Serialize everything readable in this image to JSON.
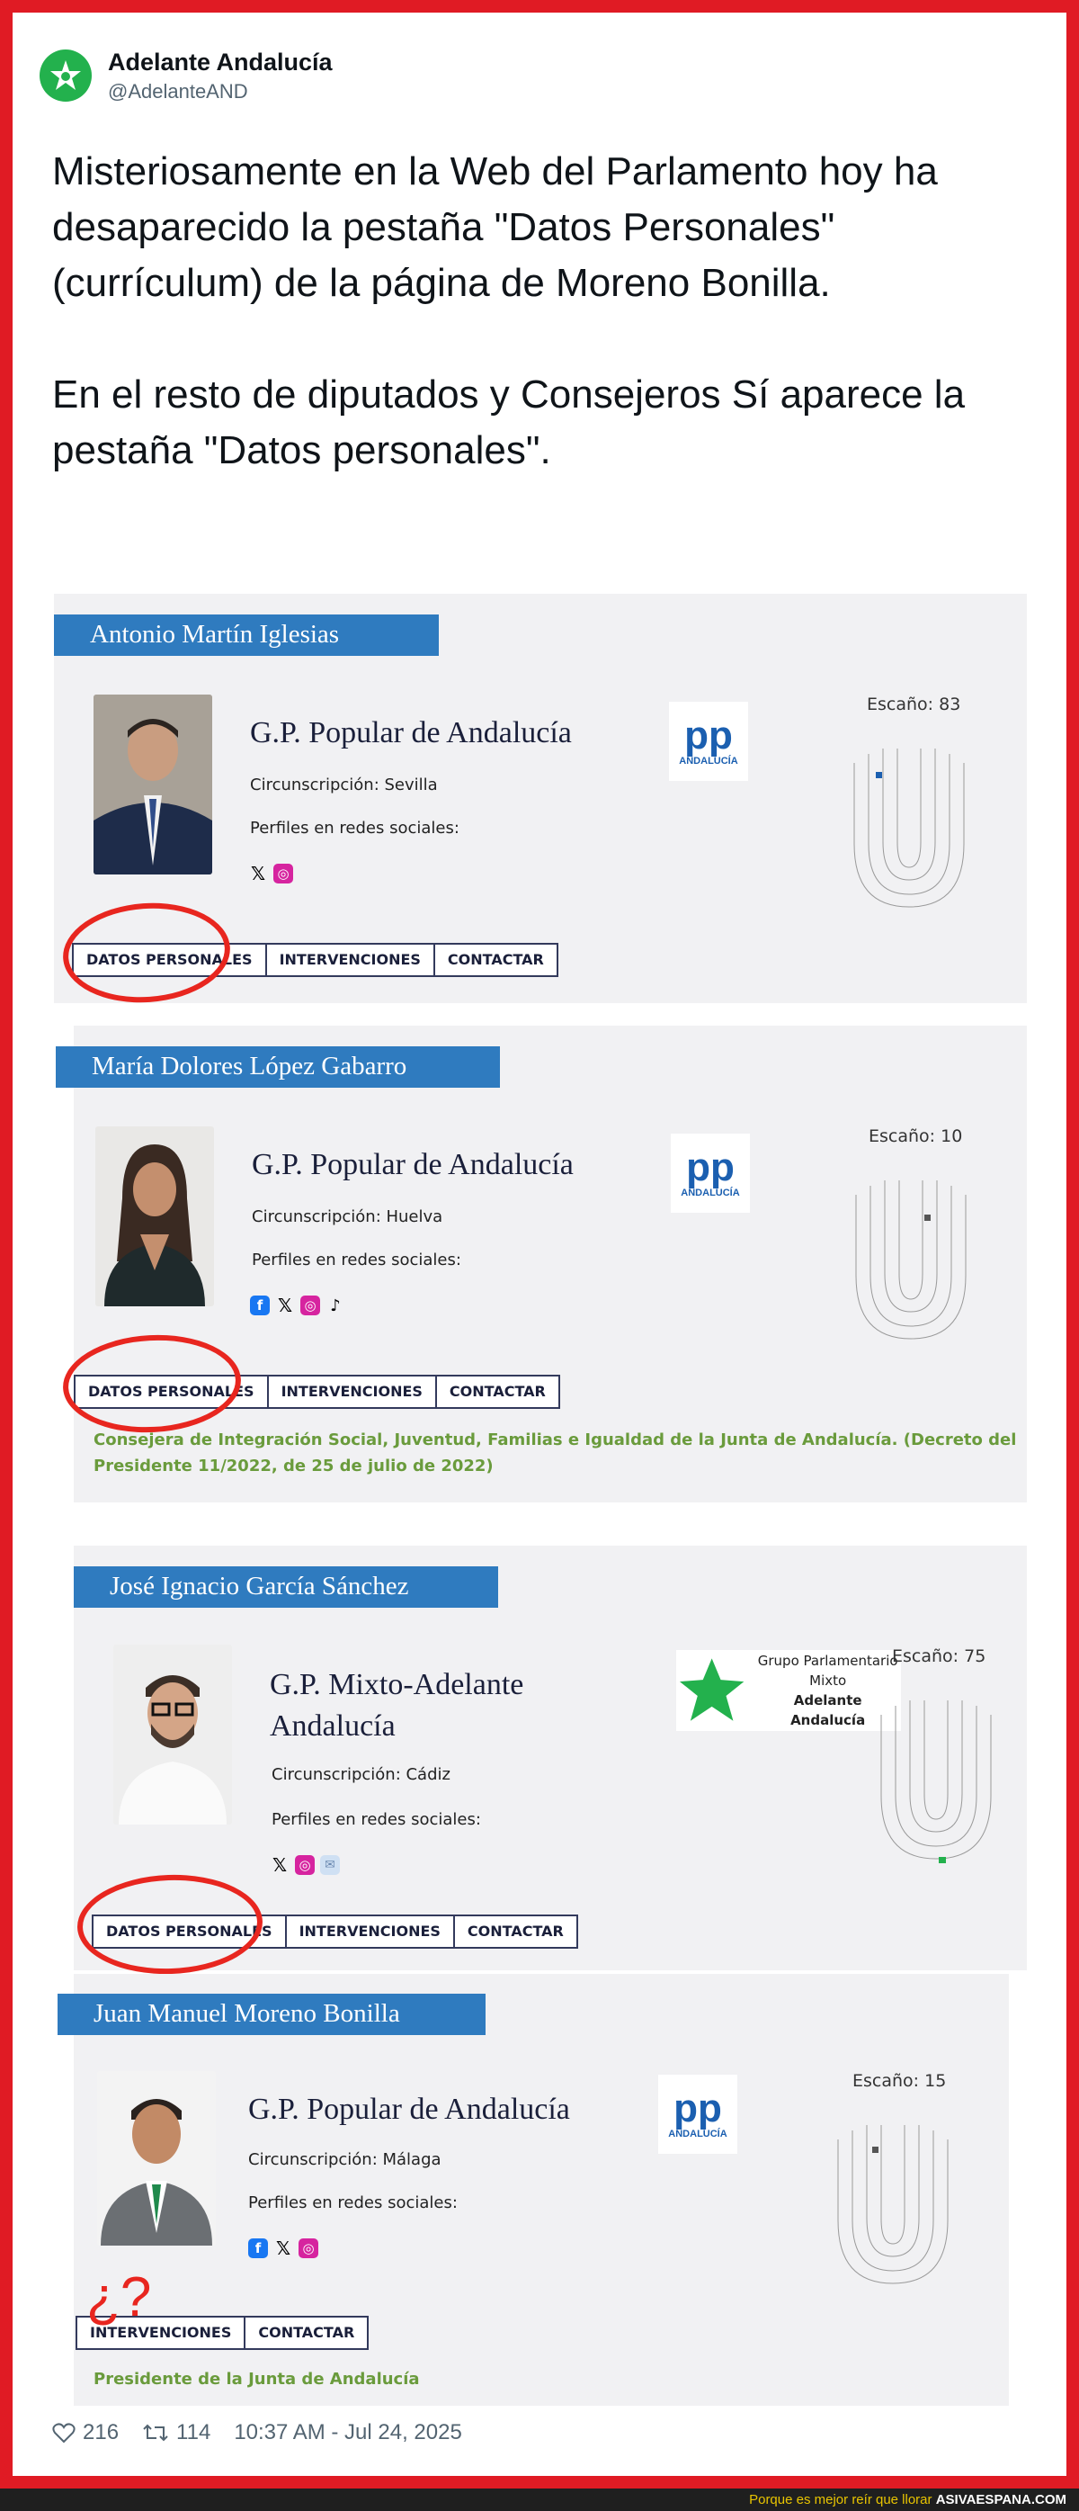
{
  "tweet": {
    "author_name": "Adelante Andalucía",
    "author_handle": "@AdelanteAND",
    "paragraph1": "Misteriosamente en la Web del Parlamento hoy ha desaparecido la pestaña \"Datos Personales\" (currículum) de la página de Moreno Bonilla.",
    "paragraph2": "En el resto de diputados y Consejeros Sí aparece la pestaña \"Datos personales\".",
    "likes": "216",
    "retweets": "114",
    "timestamp": "10:37 AM - Jul 24, 2025"
  },
  "cards": [
    {
      "name": "Antonio Martín Iglesias",
      "party": "G.P. Popular de Andalucía",
      "circ": "Circunscripción: Sevilla",
      "redes": "Perfiles en redes sociales:",
      "escano": "Escaño: 83",
      "tabs": [
        "DATOS PERSONALES",
        "INTERVENCIONES",
        "CONTACTAR"
      ],
      "logo_sub": "ANDALUCÍA"
    },
    {
      "name": "María Dolores López Gabarro",
      "party": "G.P. Popular de Andalucía",
      "circ": "Circunscripción: Huelva",
      "redes": "Perfiles en redes sociales:",
      "escano": "Escaño: 10",
      "tabs": [
        "DATOS PERSONALES",
        "INTERVENCIONES",
        "CONTACTAR"
      ],
      "note": "Consejera de Integración Social, Juventud, Familias e Igualdad de la Junta de Andalucía. (Decreto del Presidente 11/2022, de 25 de julio de 2022)",
      "logo_sub": "ANDALUCÍA"
    },
    {
      "name": "José Ignacio García Sánchez",
      "party_line1": "G.P. Mixto-Adelante",
      "party_line2": "Andalucía",
      "circ": "Circunscripción: Cádiz",
      "redes": "Perfiles en redes sociales:",
      "escano": "Escaño: 75",
      "tabs": [
        "DATOS PERSONALES",
        "INTERVENCIONES",
        "CONTACTAR"
      ],
      "logo_line1": "Grupo Parlamentario",
      "logo_line2": "Mixto",
      "logo_line3": "Adelante Andalucía"
    },
    {
      "name": "Juan Manuel Moreno Bonilla",
      "party": "G.P. Popular de Andalucía",
      "circ": "Circunscripción: Málaga",
      "redes": "Perfiles en redes sociales:",
      "escano": "Escaño: 15",
      "tabs": [
        "INTERVENCIONES",
        "CONTACTAR"
      ],
      "note": "Presidente de la Junta de Andalucía",
      "question_mark": "¿?",
      "logo_sub": "ANDALUCÍA"
    }
  ],
  "footer_bar": {
    "text": "Porque es mejor reír que llorar",
    "site": "ASIVAESPANA.COM"
  },
  "colors": {
    "frame": "#e01b24",
    "banner": "#2f7bbf",
    "note": "#6a9b3c",
    "pp_blue": "#1b5fb0",
    "adelante_green": "#23b14d"
  }
}
